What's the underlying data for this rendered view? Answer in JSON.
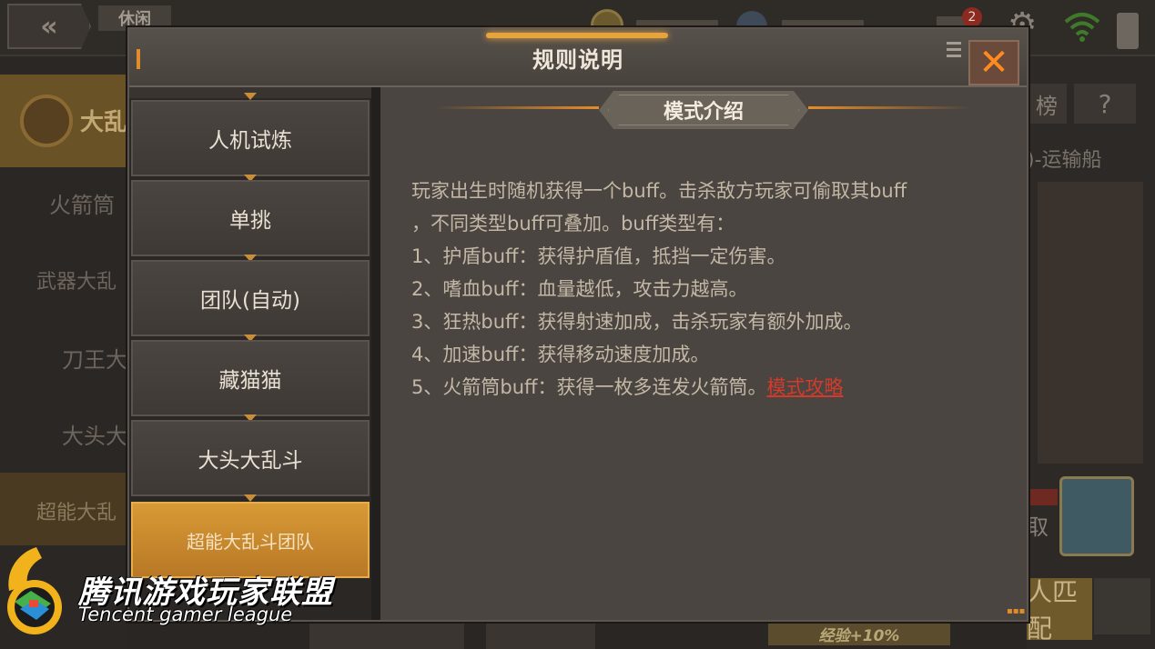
{
  "background": {
    "top_tag": "休闲",
    "mode_header_label": "大乱",
    "left_items": [
      "火箭筒",
      "武器大乱",
      "刀王大",
      "大头大",
      "超能大乱"
    ],
    "right_question": "?",
    "right_rank_fragment": "榜",
    "right_map_text": ")-运输船",
    "right_get_label": "取",
    "right_match_label": "人匹配",
    "mail_badge": "2",
    "exp_bonus": "经验+10%"
  },
  "modal": {
    "title": "规则说明",
    "close_symbol": "✕",
    "tabs": [
      {
        "label": "人机试炼",
        "active": false
      },
      {
        "label": "单挑",
        "active": false
      },
      {
        "label": "团队(自动)",
        "active": false
      },
      {
        "label": "藏猫猫",
        "active": false
      },
      {
        "label": "大头大乱斗",
        "active": false
      },
      {
        "label": "超能大乱斗团队",
        "active": true
      }
    ],
    "section_title": "模式介绍",
    "description_lines": [
      "玩家出生时随机获得一个buff。击杀敌方玩家可偷取其buff",
      "，不同类型buff可叠加。buff类型有：",
      "1、护盾buff：获得护盾值，抵挡一定伤害。",
      "2、嗜血buff：血量越低，攻击力越高。",
      "3、狂热buff：获得射速加成，击杀玩家有额外加成。",
      "4、加速buff：获得移动速度加成。",
      "5、火箭筒buff：获得一枚多连发火箭筒。"
    ],
    "strategy_link": "模式攻略"
  },
  "watermark": {
    "title": "腾讯游戏玩家联盟",
    "subtitle": "Tencent gamer league"
  },
  "icons": {
    "back": "back-double-chevron-icon",
    "close": "close-x-icon",
    "menu": "menu-lines-icon",
    "settings": "gear-icon",
    "wifi": "wifi-icon"
  },
  "colors": {
    "accent_orange": "#e78c28",
    "close_x": "#ff8a1f",
    "active_tab": "#d89a36",
    "link_red": "#d43a2a",
    "body_text": "#c3b7a6"
  }
}
